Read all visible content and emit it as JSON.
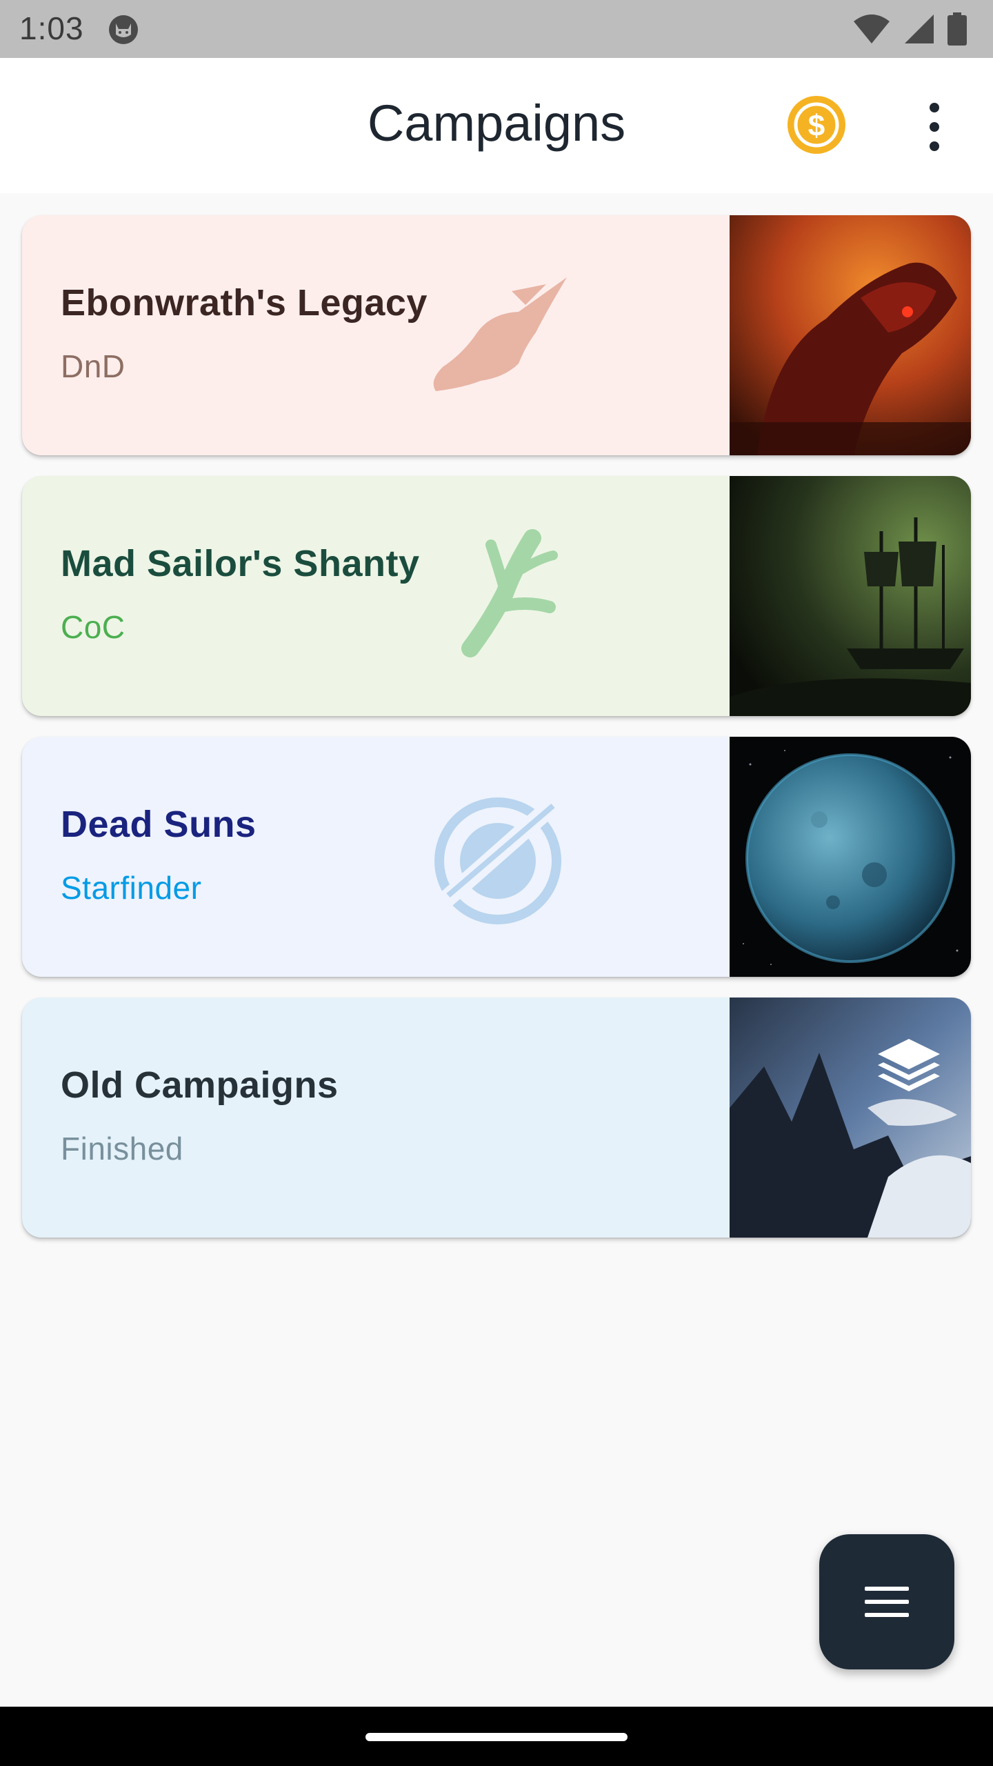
{
  "status_bar": {
    "time": "1:03"
  },
  "app_bar": {
    "title": "Campaigns",
    "coin_icon": "dollar-coin-icon",
    "menu_icon": "more-vert-icon"
  },
  "campaigns": [
    {
      "title": "Ebonwrath's Legacy",
      "system": "DnD",
      "bg": "#fdeeec",
      "title_color": "#3b2623",
      "sub_color": "#8d6e63",
      "watermark": "dragon-head-icon",
      "image": "red-dragon-artwork"
    },
    {
      "title": "Mad Sailor's Shanty",
      "system": "CoC",
      "bg": "#eef5e6",
      "title_color": "#1b4d3e",
      "sub_color": "#4caf50",
      "watermark": "tentacle-icon",
      "image": "ghost-ship-artwork"
    },
    {
      "title": "Dead Suns",
      "system": "Starfinder",
      "bg": "#eef3fd",
      "title_color": "#1a237e",
      "sub_color": "#039be5",
      "watermark": "starfinder-planet-icon",
      "image": "blue-planet-artwork"
    },
    {
      "title": "Old Campaigns",
      "system": "Finished",
      "bg": "#e5f2fa",
      "title_color": "#263238",
      "sub_color": "#78909c",
      "watermark": "",
      "image": "mountain-artwork"
    }
  ],
  "fab": {
    "icon": "menu-icon"
  }
}
